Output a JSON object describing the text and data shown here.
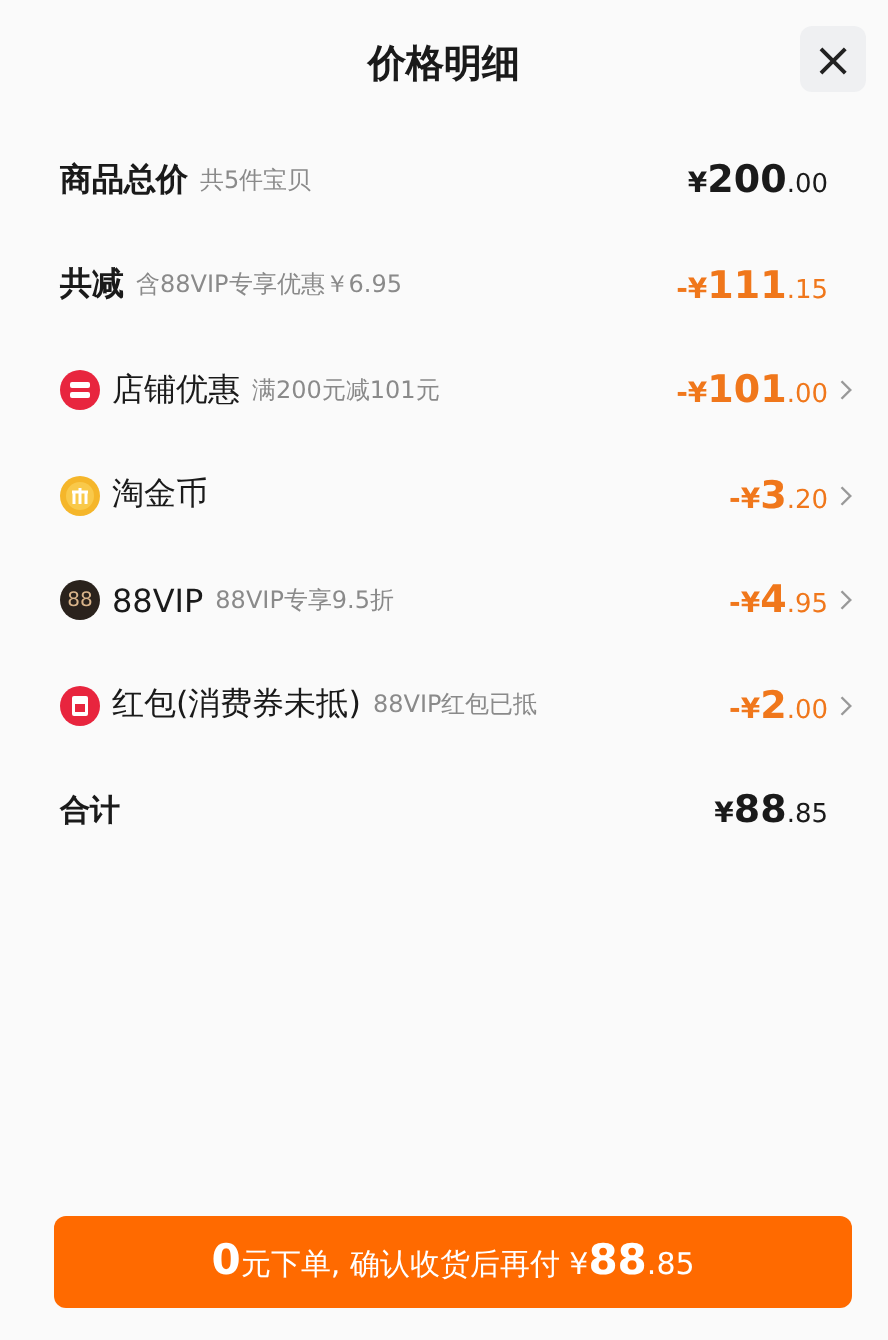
{
  "title": "价格明细",
  "close": {
    "label": "×"
  },
  "rows": [
    {
      "kind": "plain",
      "label": "商品总价",
      "note": "共5件宝贝",
      "price": {
        "sign": "¥",
        "main": "200",
        "cents": ".00"
      },
      "discount": false,
      "chevron": false
    },
    {
      "kind": "plain",
      "label": "共减",
      "note": "含88VIP专享优惠￥6.95",
      "price": {
        "sign": "-¥",
        "main": "111",
        "cents": ".15"
      },
      "discount": true,
      "chevron": false
    },
    {
      "kind": "shop",
      "label": "店铺优惠",
      "note": "满200元减101元",
      "price": {
        "sign": "-¥",
        "main": "101",
        "cents": ".00"
      },
      "discount": true,
      "chevron": true
    },
    {
      "kind": "coin",
      "label": "淘金币",
      "price": {
        "sign": "-¥",
        "main": "3",
        "cents": ".20"
      },
      "discount": true,
      "chevron": true
    },
    {
      "kind": "vip",
      "icon_text": "88",
      "label": "88VIP",
      "note": "88VIP专享9.5折",
      "price": {
        "sign": "-¥",
        "main": "4",
        "cents": ".95"
      },
      "discount": true,
      "chevron": true
    },
    {
      "kind": "packet",
      "label": "红包(消费券未抵)",
      "note": "88VIP红包已抵",
      "price": {
        "sign": "-¥",
        "main": "2",
        "cents": ".00"
      },
      "discount": true,
      "chevron": true
    },
    {
      "kind": "total",
      "label": "合计",
      "price": {
        "sign": "¥",
        "main": "88",
        "cents": ".85"
      },
      "discount": false,
      "chevron": false
    }
  ],
  "button": {
    "parts": [
      {
        "text": "0",
        "big": true
      },
      {
        "text": "元下单, 确认收货后再付 ¥",
        "big": false
      },
      {
        "text": "88",
        "big": true
      },
      {
        "text": ".85",
        "big": false
      }
    ]
  }
}
